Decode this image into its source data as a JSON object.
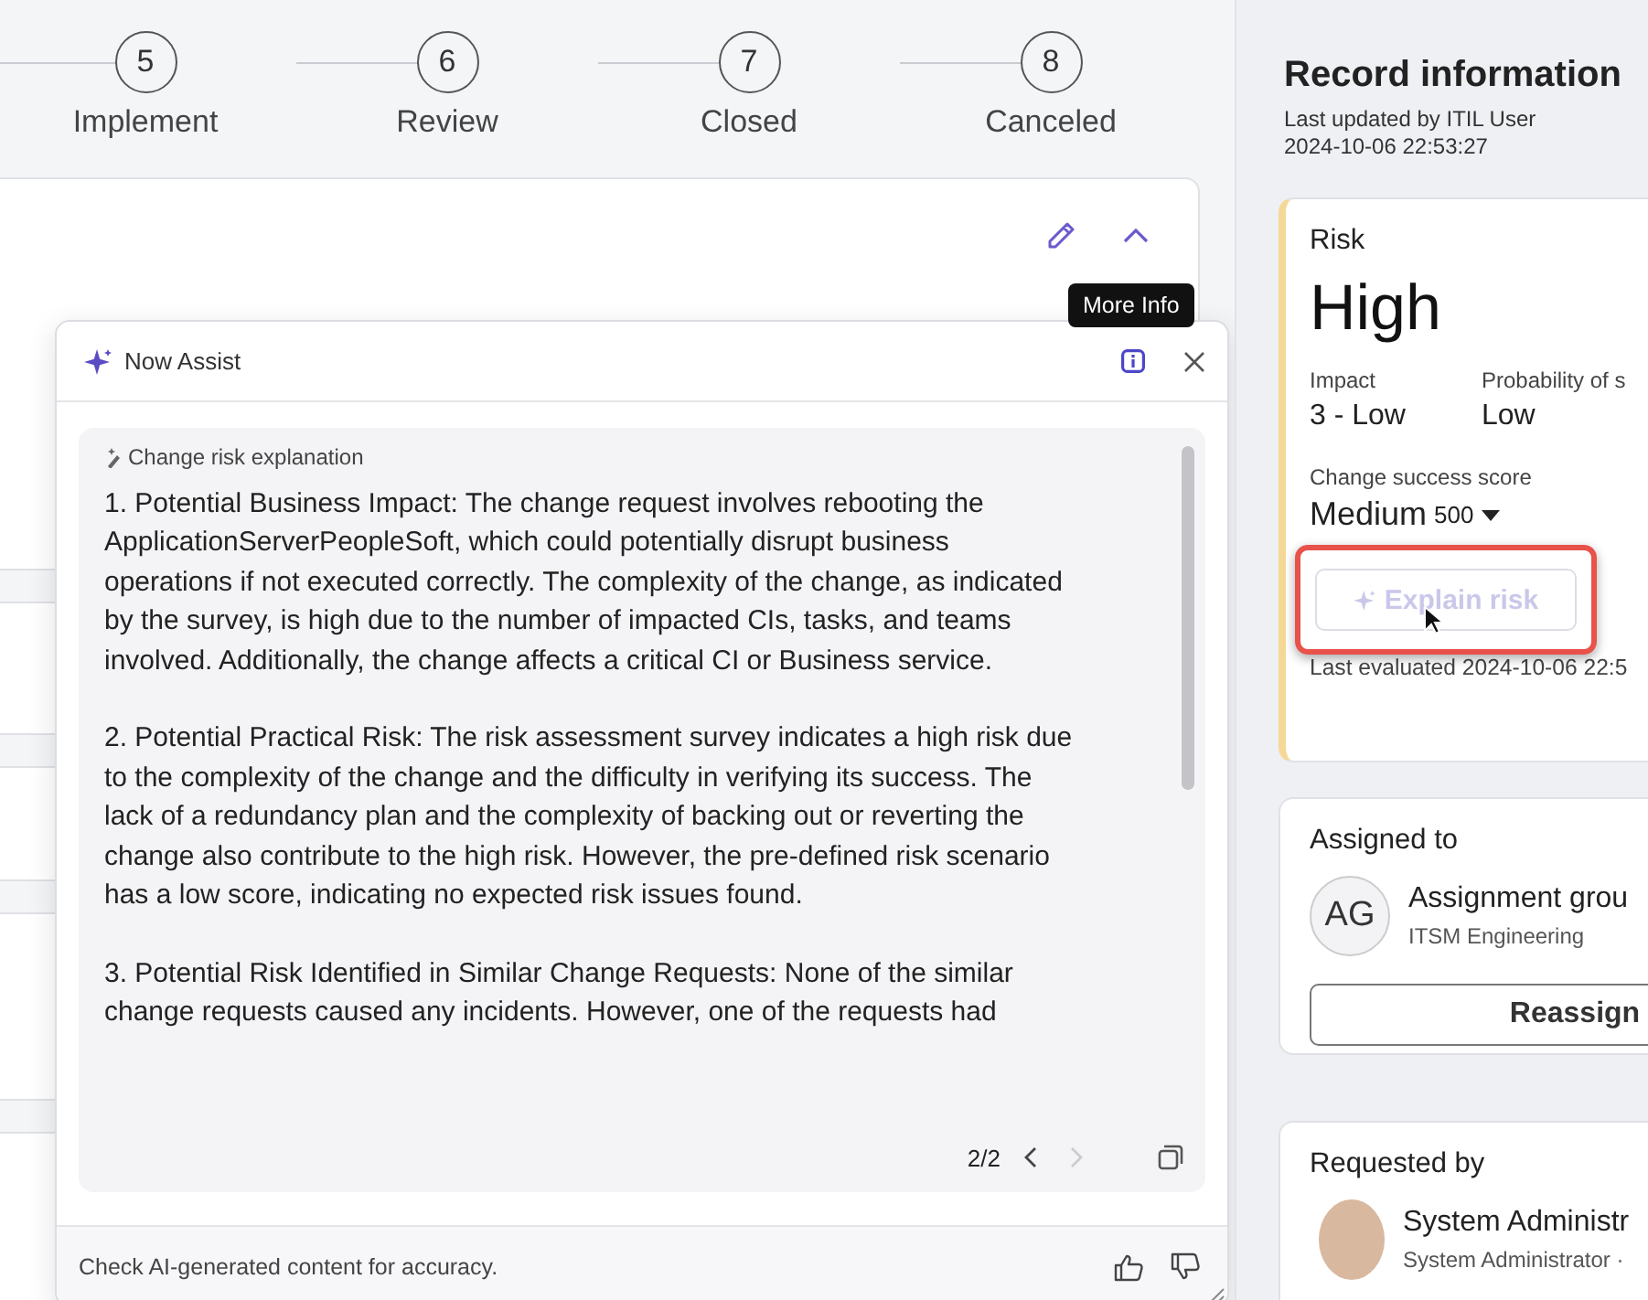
{
  "stepper": {
    "steps": [
      {
        "number": "5",
        "label": "Implement"
      },
      {
        "number": "6",
        "label": "Review"
      },
      {
        "number": "7",
        "label": "Closed"
      },
      {
        "number": "8",
        "label": "Canceled"
      }
    ]
  },
  "record_card": {
    "tooltip": "More Info"
  },
  "now_assist": {
    "title": "Now Assist",
    "section_label": "Change risk explanation",
    "paragraphs": [
      "1. Potential Business Impact: The change request involves rebooting the ApplicationServerPeopleSoft, which could potentially disrupt business operations if not executed correctly. The complexity of the change, as indicated by the survey, is high due to the number of impacted CIs, tasks, and teams involved. Additionally, the change affects a critical CI or Business service.",
      "2. Potential Practical Risk: The risk assessment survey indicates a high risk due to the complexity of the change and the difficulty in verifying its success. The lack of a redundancy plan and the complexity of backing out or reverting the change also contribute to the high risk. However, the pre-defined risk scenario has a low score, indicating no expected risk issues found.",
      "3. Potential Risk Identified in Similar Change Requests: None of the similar change requests caused any incidents. However, one of the requests had"
    ],
    "pager": "2/2",
    "prev_disabled": false,
    "next_disabled": true,
    "footer": "Check AI-generated content for accuracy."
  },
  "record_information": {
    "title": "Record information",
    "updated_by": "Last updated by ITIL User",
    "updated_at": "2024-10-06 22:53:27"
  },
  "risk_card": {
    "label": "Risk",
    "value": "High",
    "fields": [
      {
        "label": "Impact",
        "value": "3 - Low"
      },
      {
        "label": "Probability of s",
        "value": "Low"
      }
    ],
    "score_label": "Change success score",
    "score_value": "Medium",
    "score_number": "500",
    "explain_button": {
      "label": "Explain risk",
      "disabled": true,
      "highlighted": true
    },
    "last_evaluated": "Last evaluated 2024-10-06 22:5"
  },
  "assigned_card": {
    "title": "Assigned to",
    "initials": "AG",
    "name": "Assignment grou",
    "group": "ITSM Engineering",
    "button": "Reassign"
  },
  "requested_card": {
    "title": "Requested by",
    "name": "System Administr",
    "role": "System Administrator ·"
  }
}
